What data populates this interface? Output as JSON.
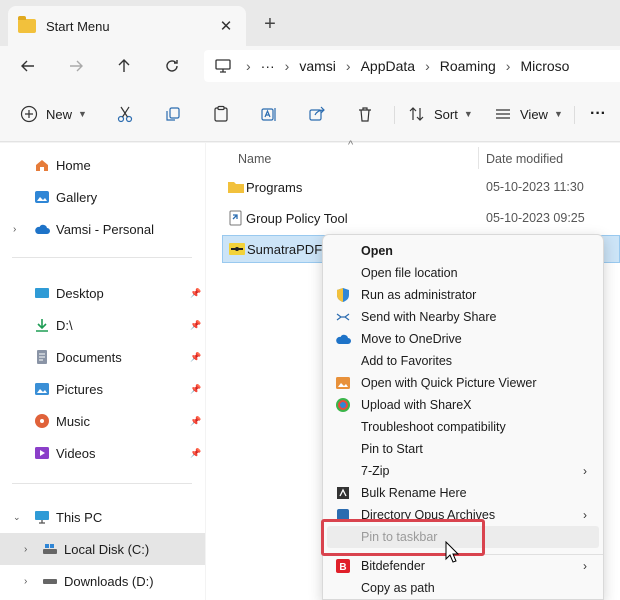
{
  "window": {
    "tab_title": "Start Menu",
    "close_glyph": "✕",
    "new_tab_glyph": "+"
  },
  "address": {
    "overflow_glyph": "···",
    "crumbs": [
      "vamsi",
      "AppData",
      "Roaming",
      "Microso"
    ]
  },
  "toolbar": {
    "new_label": "New",
    "sort_label": "Sort",
    "view_label": "View",
    "more_glyph": "···"
  },
  "nav": {
    "items": [
      {
        "label": "Home",
        "icon": "home-icon"
      },
      {
        "label": "Gallery",
        "icon": "gallery-icon"
      },
      {
        "label": "Vamsi - Personal",
        "icon": "onedrive-cloud-icon"
      },
      {
        "label": "Desktop",
        "icon": "desktop-folder-icon"
      },
      {
        "label": "D:\\",
        "icon": "download-arrow-icon"
      },
      {
        "label": "Documents",
        "icon": "documents-icon"
      },
      {
        "label": "Pictures",
        "icon": "pictures-icon"
      },
      {
        "label": "Music",
        "icon": "music-icon"
      },
      {
        "label": "Videos",
        "icon": "videos-icon"
      },
      {
        "label": "This PC",
        "icon": "monitor-icon"
      },
      {
        "label": "Local Disk (C:)",
        "icon": "drive-c-icon"
      },
      {
        "label": "Downloads (D:)",
        "icon": "drive-icon"
      }
    ]
  },
  "filelist": {
    "col_name": "Name",
    "col_date": "Date modified",
    "rows": [
      {
        "name": "Programs",
        "date": "05-10-2023 11:30"
      },
      {
        "name": "Group Policy Tool",
        "date": "05-10-2023 09:25"
      },
      {
        "name": "SumatraPDF",
        "date": ""
      }
    ]
  },
  "context_menu": {
    "items": [
      "Open",
      "Open file location",
      "Run as administrator",
      "Send with Nearby Share",
      "Move to OneDrive",
      "Add to Favorites",
      "Open with Quick Picture Viewer",
      "Upload with ShareX",
      "Troubleshoot compatibility",
      "Pin to Start",
      "7-Zip",
      "Bulk Rename Here",
      "Directory Opus Archives",
      "Pin to taskbar",
      "Bitdefender",
      "Copy as path"
    ]
  },
  "colors": {
    "selection": "#cce4f7",
    "highlight_box": "#d9434e",
    "folder": "#f2c13c"
  }
}
